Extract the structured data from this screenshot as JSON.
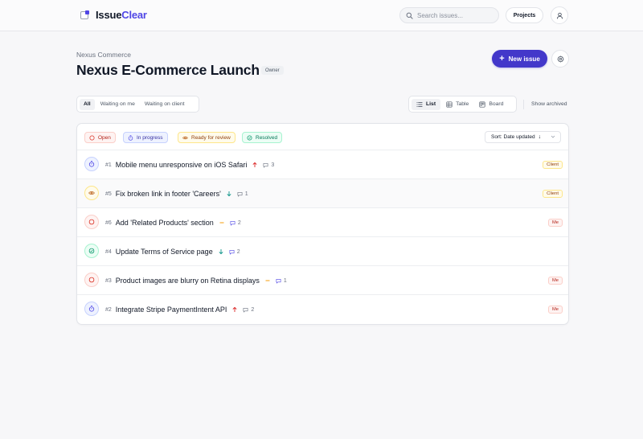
{
  "app": {
    "name_part1": "Issue",
    "name_part2": "Clear",
    "brand_color": "#4f46e5"
  },
  "topbar": {
    "search_placeholder": "Search issues...",
    "projects_label": "Projects",
    "user_icon": "user-icon"
  },
  "header": {
    "breadcrumb": "Nexus Commerce",
    "title": "Nexus E-Commerce Launch",
    "role_badge": "Owner",
    "new_issue_label": "New issue",
    "settings_icon": "gear-icon"
  },
  "filters": {
    "tabs": [
      {
        "label": "All",
        "active": true
      },
      {
        "label": "Waiting on me",
        "active": false
      },
      {
        "label": "Waiting on client",
        "active": false
      }
    ]
  },
  "views": {
    "tabs": [
      {
        "label": "List",
        "icon": "list-icon",
        "active": true
      },
      {
        "label": "Table",
        "icon": "table-icon",
        "active": false
      },
      {
        "label": "Board",
        "icon": "board-icon",
        "active": false
      }
    ],
    "show_archived": "Show archived"
  },
  "status_filters": [
    {
      "label": "Open",
      "color": "#b42318"
    },
    {
      "label": "In progress",
      "color": "#3730a3"
    },
    {
      "label": "Ready for review",
      "color": "#92400e"
    },
    {
      "label": "Resolved",
      "color": "#047857"
    }
  ],
  "sort": {
    "label": "Sort: Date updated",
    "direction": "↓"
  },
  "issues": [
    {
      "status": "in-progress",
      "number": "#1",
      "title": "Mobile menu unresponsive on iOS Safari",
      "priority": "high",
      "comments": "3",
      "tag": "Client"
    },
    {
      "status": "ready-for-review",
      "number": "#5",
      "title": "Fix broken link in footer 'Careers'",
      "priority": "low",
      "comments": "1",
      "tag": "Client"
    },
    {
      "status": "open",
      "number": "#6",
      "title": "Add 'Related Products' section",
      "priority": "medium",
      "comments": "2",
      "tag": "Me"
    },
    {
      "status": "resolved",
      "number": "#4",
      "title": "Update Terms of Service page",
      "priority": "low",
      "comments": "2",
      "tag": ""
    },
    {
      "status": "open",
      "number": "#3",
      "title": "Product images are blurry on Retina displays",
      "priority": "medium",
      "comments": "1",
      "tag": "Me"
    },
    {
      "status": "in-progress",
      "number": "#2",
      "title": "Integrate Stripe PaymentIntent API",
      "priority": "high",
      "comments": "2",
      "tag": "Me"
    }
  ]
}
